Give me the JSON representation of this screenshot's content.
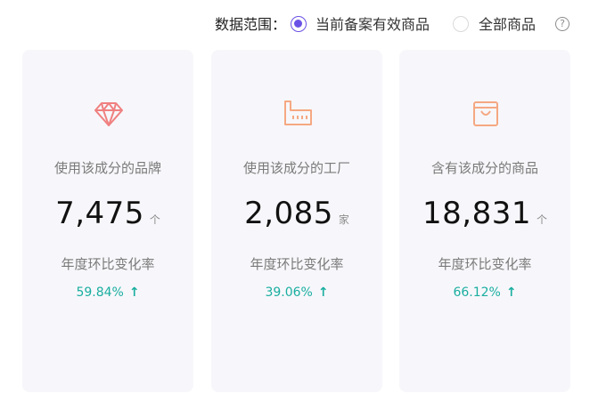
{
  "scope": {
    "label": "数据范围：",
    "options": [
      {
        "label": "当前备案有效商品",
        "checked": true
      },
      {
        "label": "全部商品",
        "checked": false
      }
    ],
    "help": "?"
  },
  "colors": {
    "accent": "#6b52e6",
    "rate": "#1aaea0",
    "icon_red": "#f08080",
    "icon_orange": "#f5a882"
  },
  "cards": [
    {
      "icon": "diamond-icon",
      "label": "使用该成分的品牌",
      "value": "7,475",
      "unit": "个",
      "sublabel": "年度环比变化率",
      "rate": "59.84%",
      "arrow": "↑"
    },
    {
      "icon": "factory-icon",
      "label": "使用该成分的工厂",
      "value": "2,085",
      "unit": "家",
      "sublabel": "年度环比变化率",
      "rate": "39.06%",
      "arrow": "↑"
    },
    {
      "icon": "shopping-bag-icon",
      "label": "含有该成分的商品",
      "value": "18,831",
      "unit": "个",
      "sublabel": "年度环比变化率",
      "rate": "66.12%",
      "arrow": "↑"
    }
  ]
}
